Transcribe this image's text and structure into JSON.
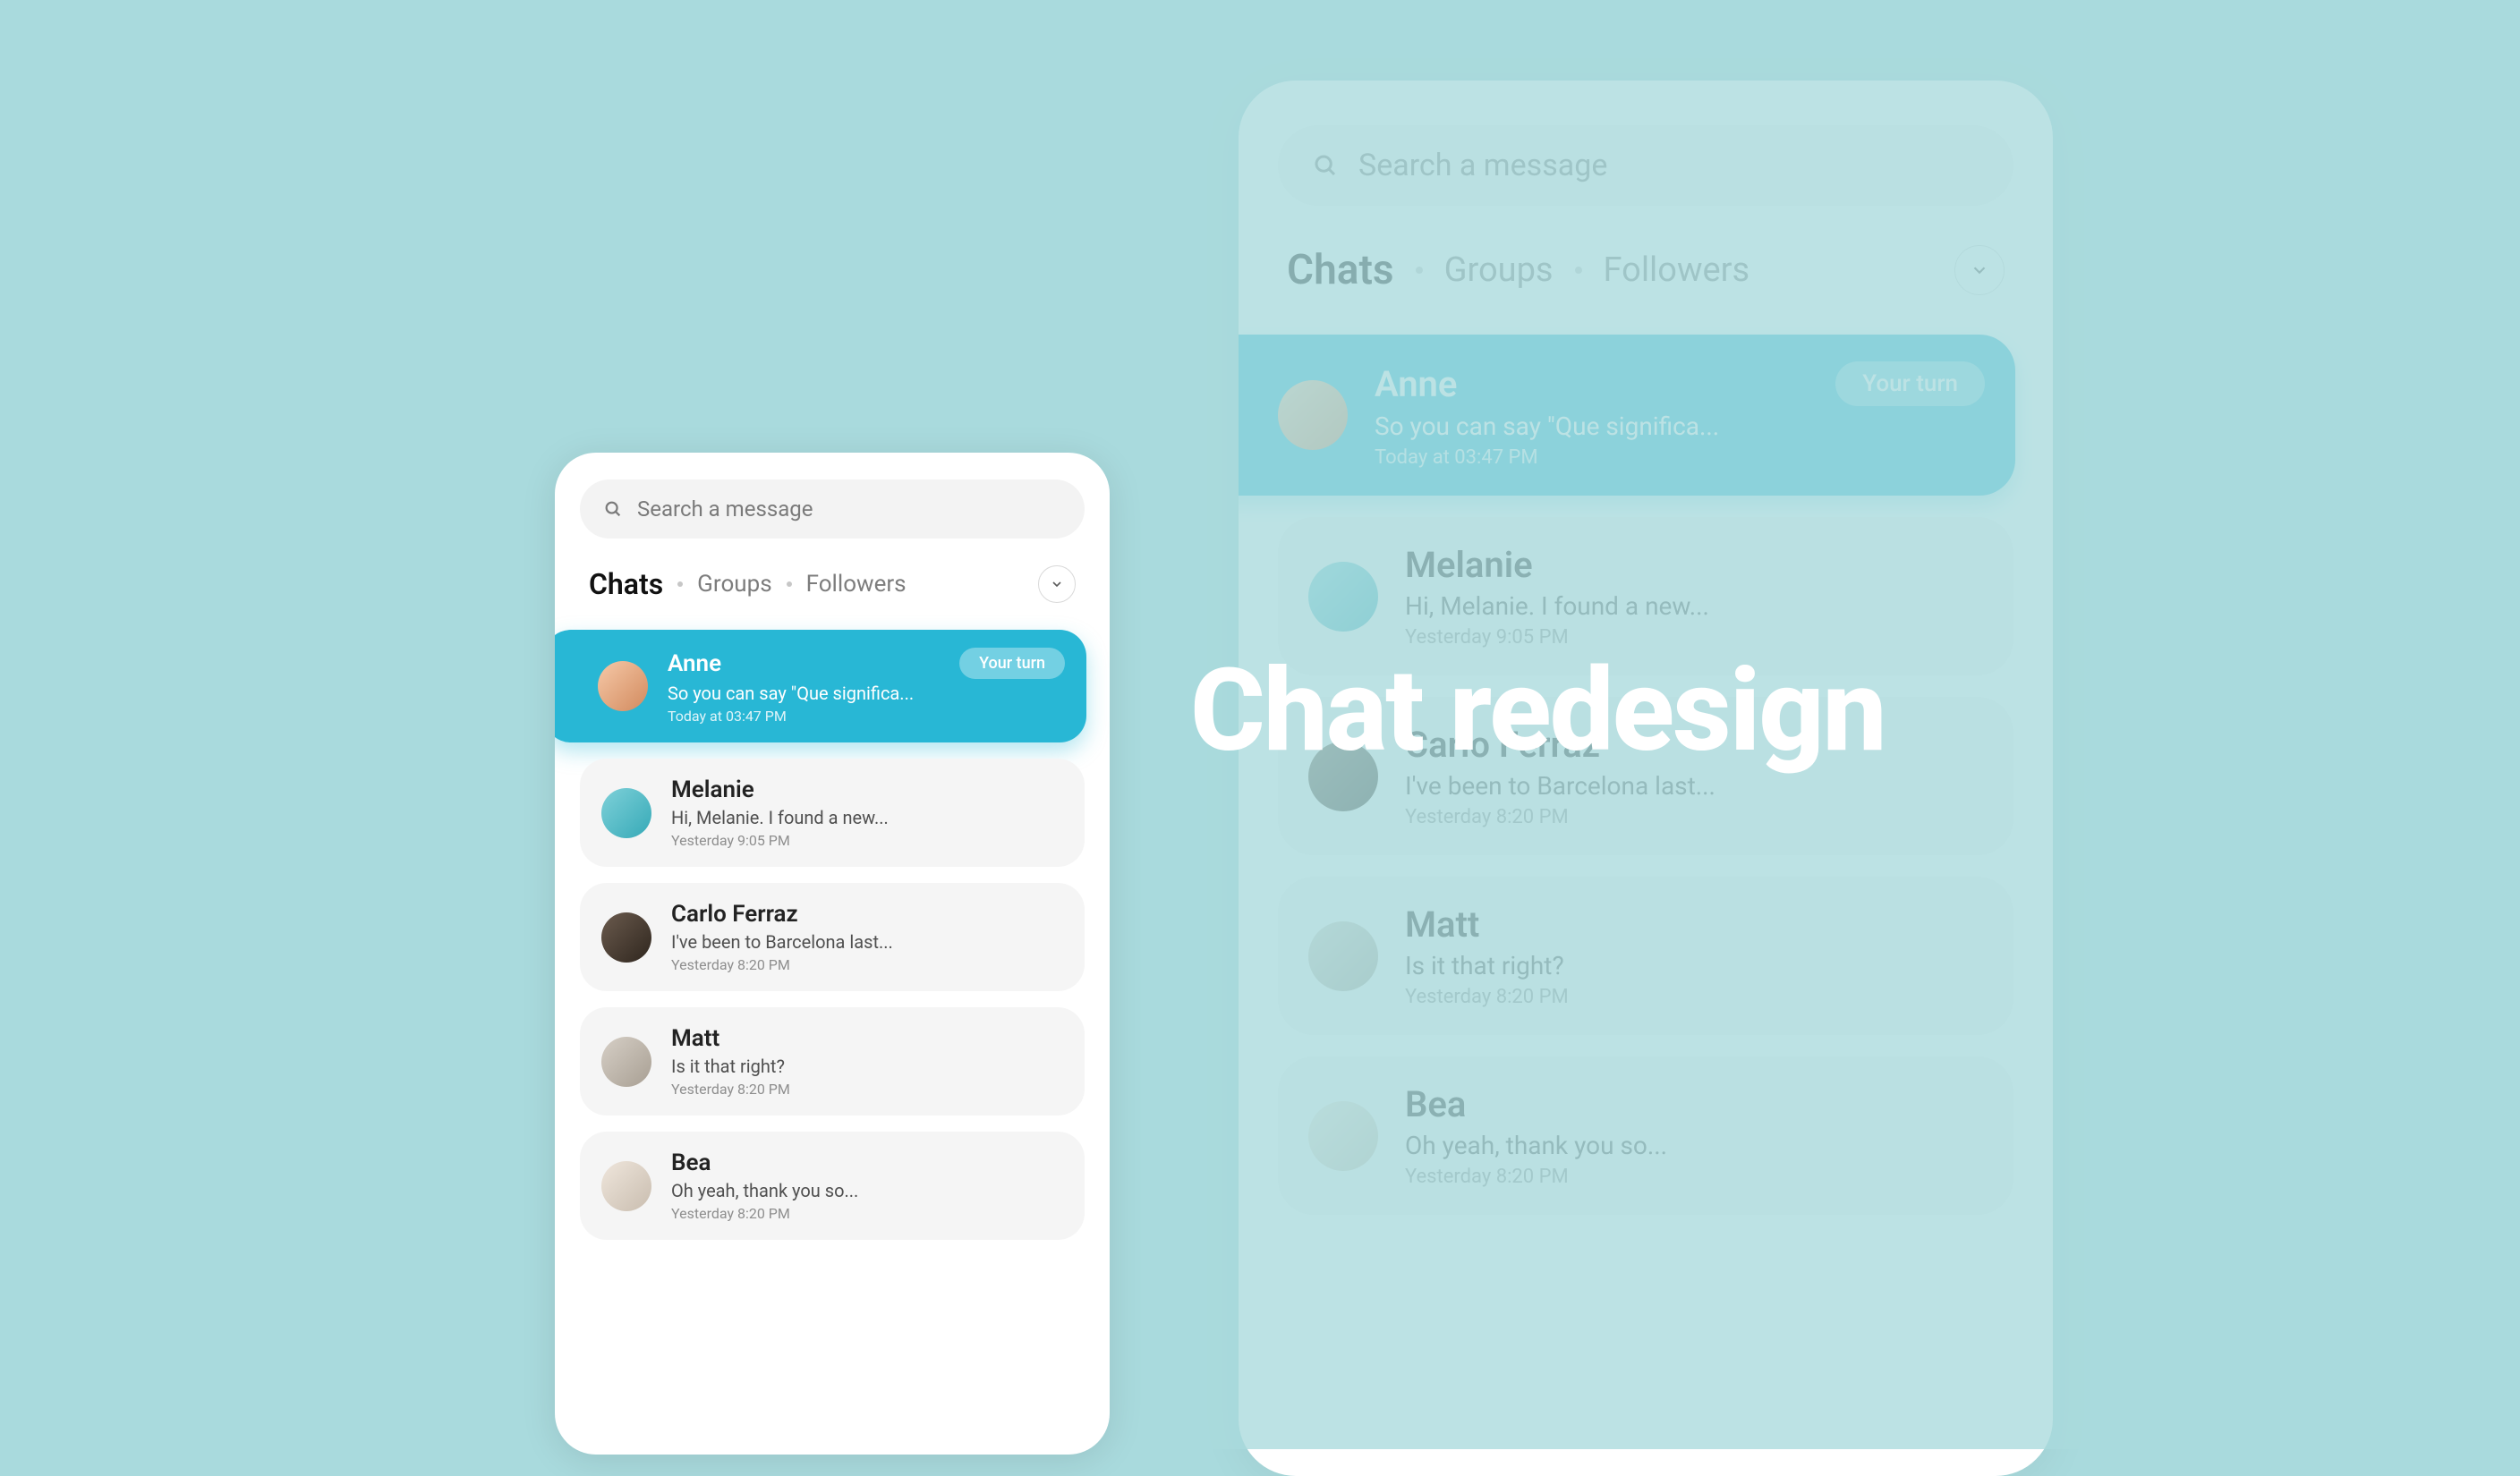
{
  "hero_text": "Chat redesign",
  "search": {
    "placeholder": "Search a message"
  },
  "tabs": {
    "items": [
      "Chats",
      "Groups",
      "Followers"
    ],
    "active_index": 0
  },
  "chats": [
    {
      "name": "Anne",
      "preview": "So you can say \"Que significa...",
      "time": "Today at 03:47 PM",
      "badge": "Your turn",
      "highlight": true,
      "avatar_class": "av-a"
    },
    {
      "name": "Melanie",
      "preview": "Hi, Melanie. I found a new...",
      "time": "Yesterday 9:05 PM",
      "highlight": false,
      "avatar_class": "av-b"
    },
    {
      "name": "Carlo Ferraz",
      "preview": "I've been to Barcelona last...",
      "time": "Yesterday 8:20 PM",
      "highlight": false,
      "avatar_class": "av-c"
    },
    {
      "name": "Matt",
      "preview": "Is it that right?",
      "time": "Yesterday 8:20 PM",
      "highlight": false,
      "avatar_class": "av-d"
    },
    {
      "name": "Bea",
      "preview": "Oh yeah, thank you so...",
      "time": "Yesterday 8:20 PM",
      "highlight": false,
      "avatar_class": "av-e"
    }
  ]
}
